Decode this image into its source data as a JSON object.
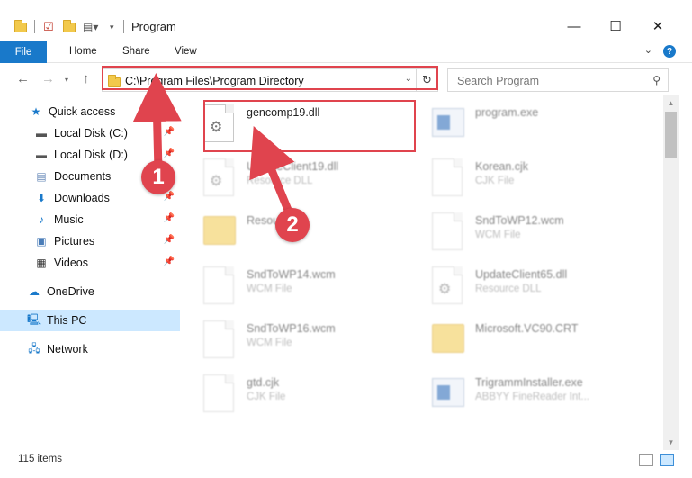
{
  "window": {
    "title": "Program",
    "minimize": "—",
    "maximize": "☐",
    "close": "✕"
  },
  "ribbon": {
    "tabs": [
      "File",
      "Home",
      "Share",
      "View"
    ],
    "help": "?"
  },
  "nav": {
    "address": "C:\\Program Files\\Program Directory",
    "search_placeholder": "Search Program"
  },
  "sidebar": {
    "items": [
      {
        "label": "Quick access",
        "icon": "star-icon"
      },
      {
        "label": "Local Disk (C:)",
        "icon": "drive-icon"
      },
      {
        "label": "Local Disk (D:)",
        "icon": "drive-icon"
      },
      {
        "label": "Documents",
        "icon": "documents-icon"
      },
      {
        "label": "Downloads",
        "icon": "download-icon"
      },
      {
        "label": "Music",
        "icon": "music-icon"
      },
      {
        "label": "Pictures",
        "icon": "pictures-icon"
      },
      {
        "label": "Videos",
        "icon": "videos-icon"
      },
      {
        "label": "OneDrive",
        "icon": "cloud-icon"
      },
      {
        "label": "This PC",
        "icon": "computer-icon"
      },
      {
        "label": "Network",
        "icon": "network-icon"
      }
    ]
  },
  "files": [
    {
      "name": "gencomp19.dll",
      "desc": "",
      "icon": "dll-icon"
    },
    {
      "name": "program.exe",
      "desc": "",
      "icon": "exe-icon"
    },
    {
      "name": "UpdateClient19.dll",
      "desc": "Resource DLL",
      "icon": "dll-icon"
    },
    {
      "name": "Korean.cjk",
      "desc": "CJK File",
      "icon": "file-icon"
    },
    {
      "name": "Resources",
      "desc": "",
      "icon": "folder-icon"
    },
    {
      "name": "SndToWP12.wcm",
      "desc": "WCM File",
      "icon": "file-icon"
    },
    {
      "name": "SndToWP14.wcm",
      "desc": "WCM File",
      "icon": "file-icon"
    },
    {
      "name": "UpdateClient65.dll",
      "desc": "Resource DLL",
      "icon": "dll-icon"
    },
    {
      "name": "SndToWP16.wcm",
      "desc": "WCM File",
      "icon": "file-icon"
    },
    {
      "name": "Microsoft.VC90.CRT",
      "desc": "",
      "icon": "folder-icon"
    },
    {
      "name": "gtd.cjk",
      "desc": "CJK File",
      "icon": "file-icon"
    },
    {
      "name": "TrigrammInstaller.exe",
      "desc": "ABBYY FineReader Int...",
      "icon": "exe-icon"
    }
  ],
  "status": {
    "count": "115 items"
  },
  "annotations": {
    "step1": "1",
    "step2": "2",
    "color": "#e0444e"
  }
}
